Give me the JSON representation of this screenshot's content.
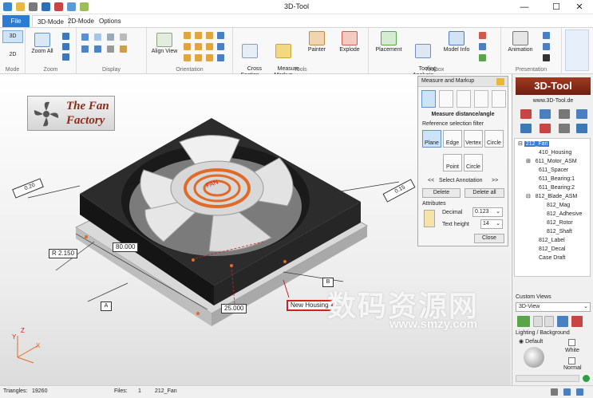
{
  "window": {
    "title": "3D-Tool",
    "minimize": "—",
    "maximize": "☐",
    "close": "✕"
  },
  "tabs": {
    "file": "File",
    "mode3d": "3D-Mode",
    "mode2d": "2D-Mode",
    "options": "Options"
  },
  "ribbon": {
    "mode": {
      "b3d": "3D",
      "b2d": "2D",
      "label": "Mode"
    },
    "zoom": {
      "zoom_all": "Zoom All",
      "label": "Zoom"
    },
    "display": {
      "label": "Display"
    },
    "orientation": {
      "align_view": "Align View",
      "label": "Orientation"
    },
    "tools": {
      "cross": "Cross\nSection",
      "measure": "Measure\nMarkup",
      "painter": "Painter",
      "explode": "Explode",
      "label": "Tools"
    },
    "toolbox": {
      "placement": "Placement",
      "tooling": "Tooling\nAnalysis",
      "model_info": "Model Info",
      "label": "Toolbox"
    },
    "presentation": {
      "animation": "Animation",
      "label": "Presentation"
    }
  },
  "viewport": {
    "logo_line1": "The Fan",
    "logo_line2": "Factory",
    "fan_text": "FAN",
    "dim_r": "R 2.150",
    "dim_80": "80.000",
    "dim_25": "25.000",
    "callout": "New Housing",
    "flag_a": "A",
    "flag_b": "B",
    "tol_left": "0.20",
    "tol_right": "0.15",
    "axis_x": "X",
    "axis_y": "Y",
    "axis_z": "Z",
    "watermark_cn": "数码资源网",
    "watermark_url": "www.smzy.com"
  },
  "measure_panel": {
    "title": "Measure and Markup",
    "heading": "Measure distance/angle",
    "filter_label": "Reference selection filter",
    "filters": [
      "Plane",
      "Edge",
      "Vertex",
      "Circle"
    ],
    "filters2": [
      "Point",
      "Circle"
    ],
    "select_annotation": "Select Annotation",
    "prev": "<<",
    "next": ">>",
    "delete": "Delete",
    "delete_all": "Delete all",
    "attributes": "Attributes",
    "decimal_label": "Decimal",
    "decimal_value": "0.123",
    "text_height_label": "Text height",
    "text_height_value": "14",
    "close": "Close"
  },
  "right_panel": {
    "brand": "3D-Tool",
    "url": "www.3D-Tool.de",
    "tree": [
      "212_Fan",
      "410_Housing",
      "611_Motor_ASM",
      "611_Spacer",
      "611_Bearing:1",
      "611_Bearing:2",
      "812_Blade_ASM",
      "812_Mag",
      "812_Adhesive",
      "812_Rotor",
      "812_Shaft",
      "812_Label",
      "812_Decal",
      "Case Draft"
    ],
    "custom_views": "Custom Views",
    "view_value": "3D-View",
    "lighting": "Lighting / Background",
    "default": "Default",
    "white": "White",
    "normal": "Normal"
  },
  "status": {
    "triangles_label": "Triangles:",
    "triangles_value": "19260",
    "files_label": "Files:",
    "files_value": "1",
    "file_name": "212_Fan"
  },
  "colors": {
    "accent": "#2b7cd3",
    "callout": "#d21f1f",
    "fan_body": "#1e1e1e",
    "coil": "#e06a28",
    "brand_bg": "#8a2a1a"
  }
}
